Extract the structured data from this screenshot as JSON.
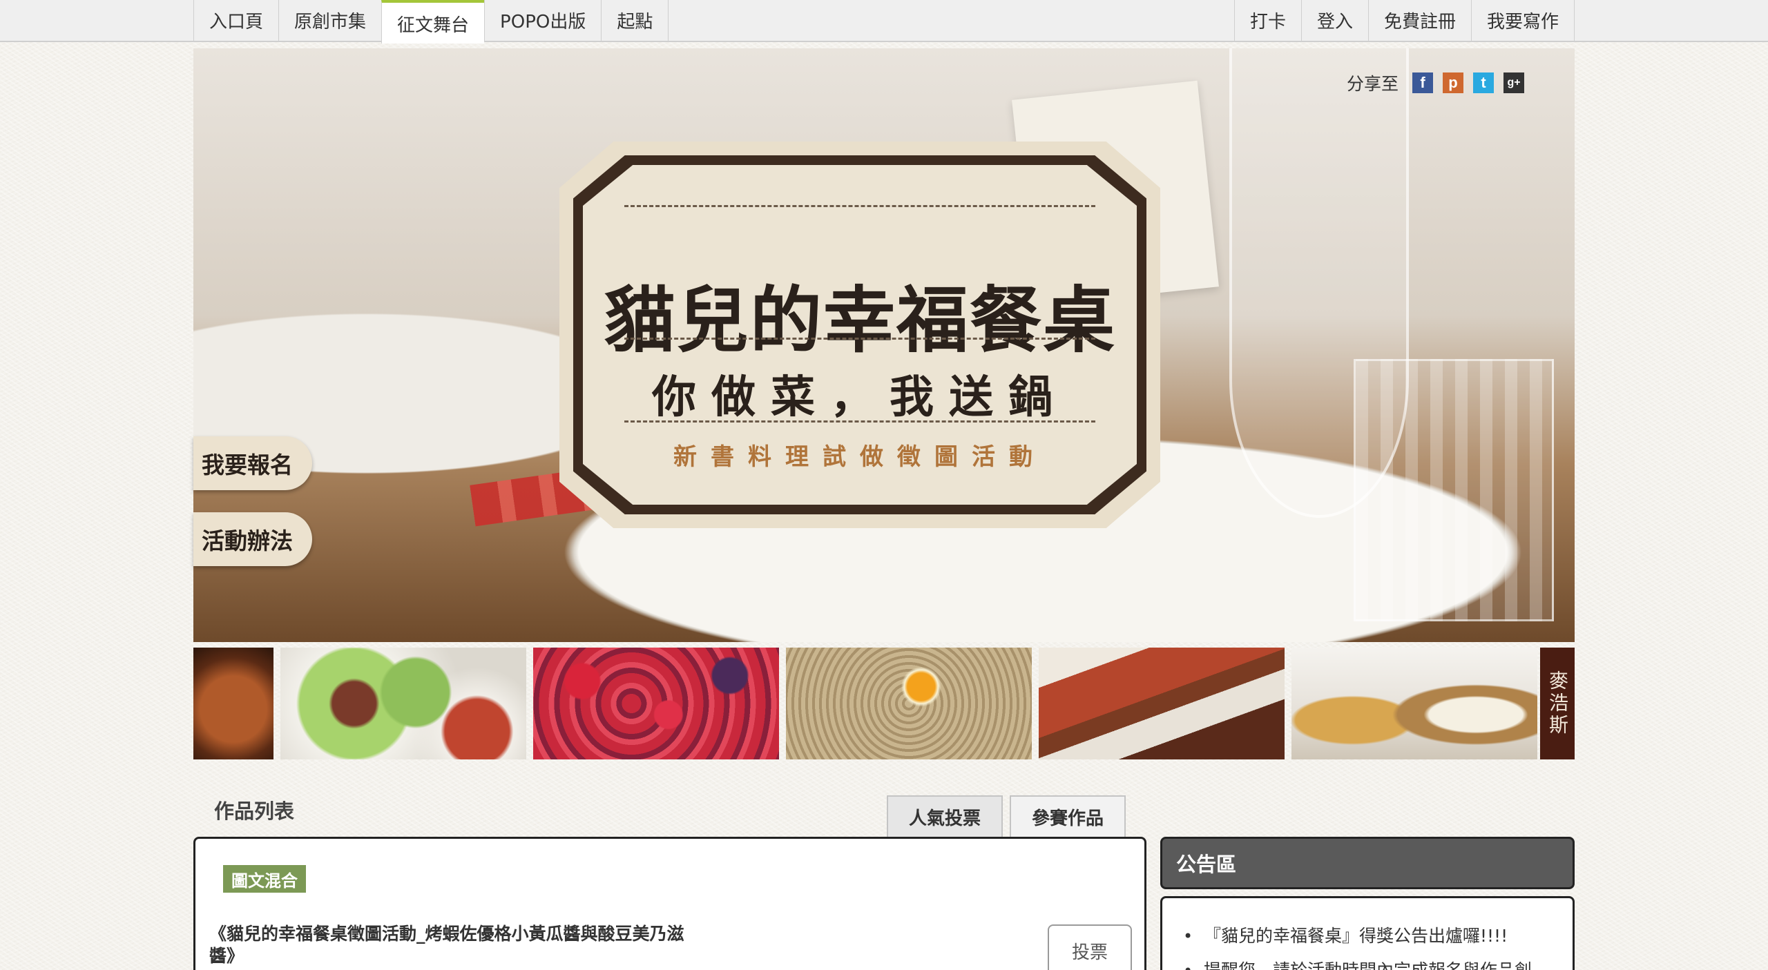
{
  "nav": {
    "left": [
      "入口頁",
      "原創市集",
      "征文舞台",
      "POPO出版",
      "起點"
    ],
    "right": [
      "打卡",
      "登入",
      "免費註冊",
      "我要寫作"
    ],
    "active_index": 2
  },
  "hero": {
    "title": "貓兒的幸福餐桌",
    "subtitle": "你做菜，我送鍋",
    "tagline": "新書料理試做徵圖活動",
    "side_buttons": [
      "我要報名",
      "活動辦法"
    ],
    "share_label": "分享至",
    "share_icons": [
      {
        "name": "facebook-icon",
        "glyph": "f",
        "color": "#3b5998"
      },
      {
        "name": "plurk-icon",
        "glyph": "p",
        "color": "#cf682f"
      },
      {
        "name": "twitter-icon",
        "glyph": "t",
        "color": "#2aa9e0"
      },
      {
        "name": "google-plus-icon",
        "glyph": "g+",
        "color": "#333333"
      }
    ]
  },
  "thumb_strip": {
    "label": "麥浩斯"
  },
  "works": {
    "section_title": "作品列表",
    "tabs": [
      "人氣投票",
      "參賽作品"
    ],
    "items": [
      {
        "category": "圖文混合",
        "title": "《貓兒的幸福餐桌徵圖活動_烤蝦佐優格小黃瓜醬與酸豆美乃滋醬》",
        "vote_label": "投票"
      }
    ]
  },
  "notice": {
    "title": "公告區",
    "items": [
      "『貓兒的幸福餐桌』得獎公告出爐囉!!!!",
      "提醒您，請於活動時間內完成報名與作品創"
    ]
  }
}
